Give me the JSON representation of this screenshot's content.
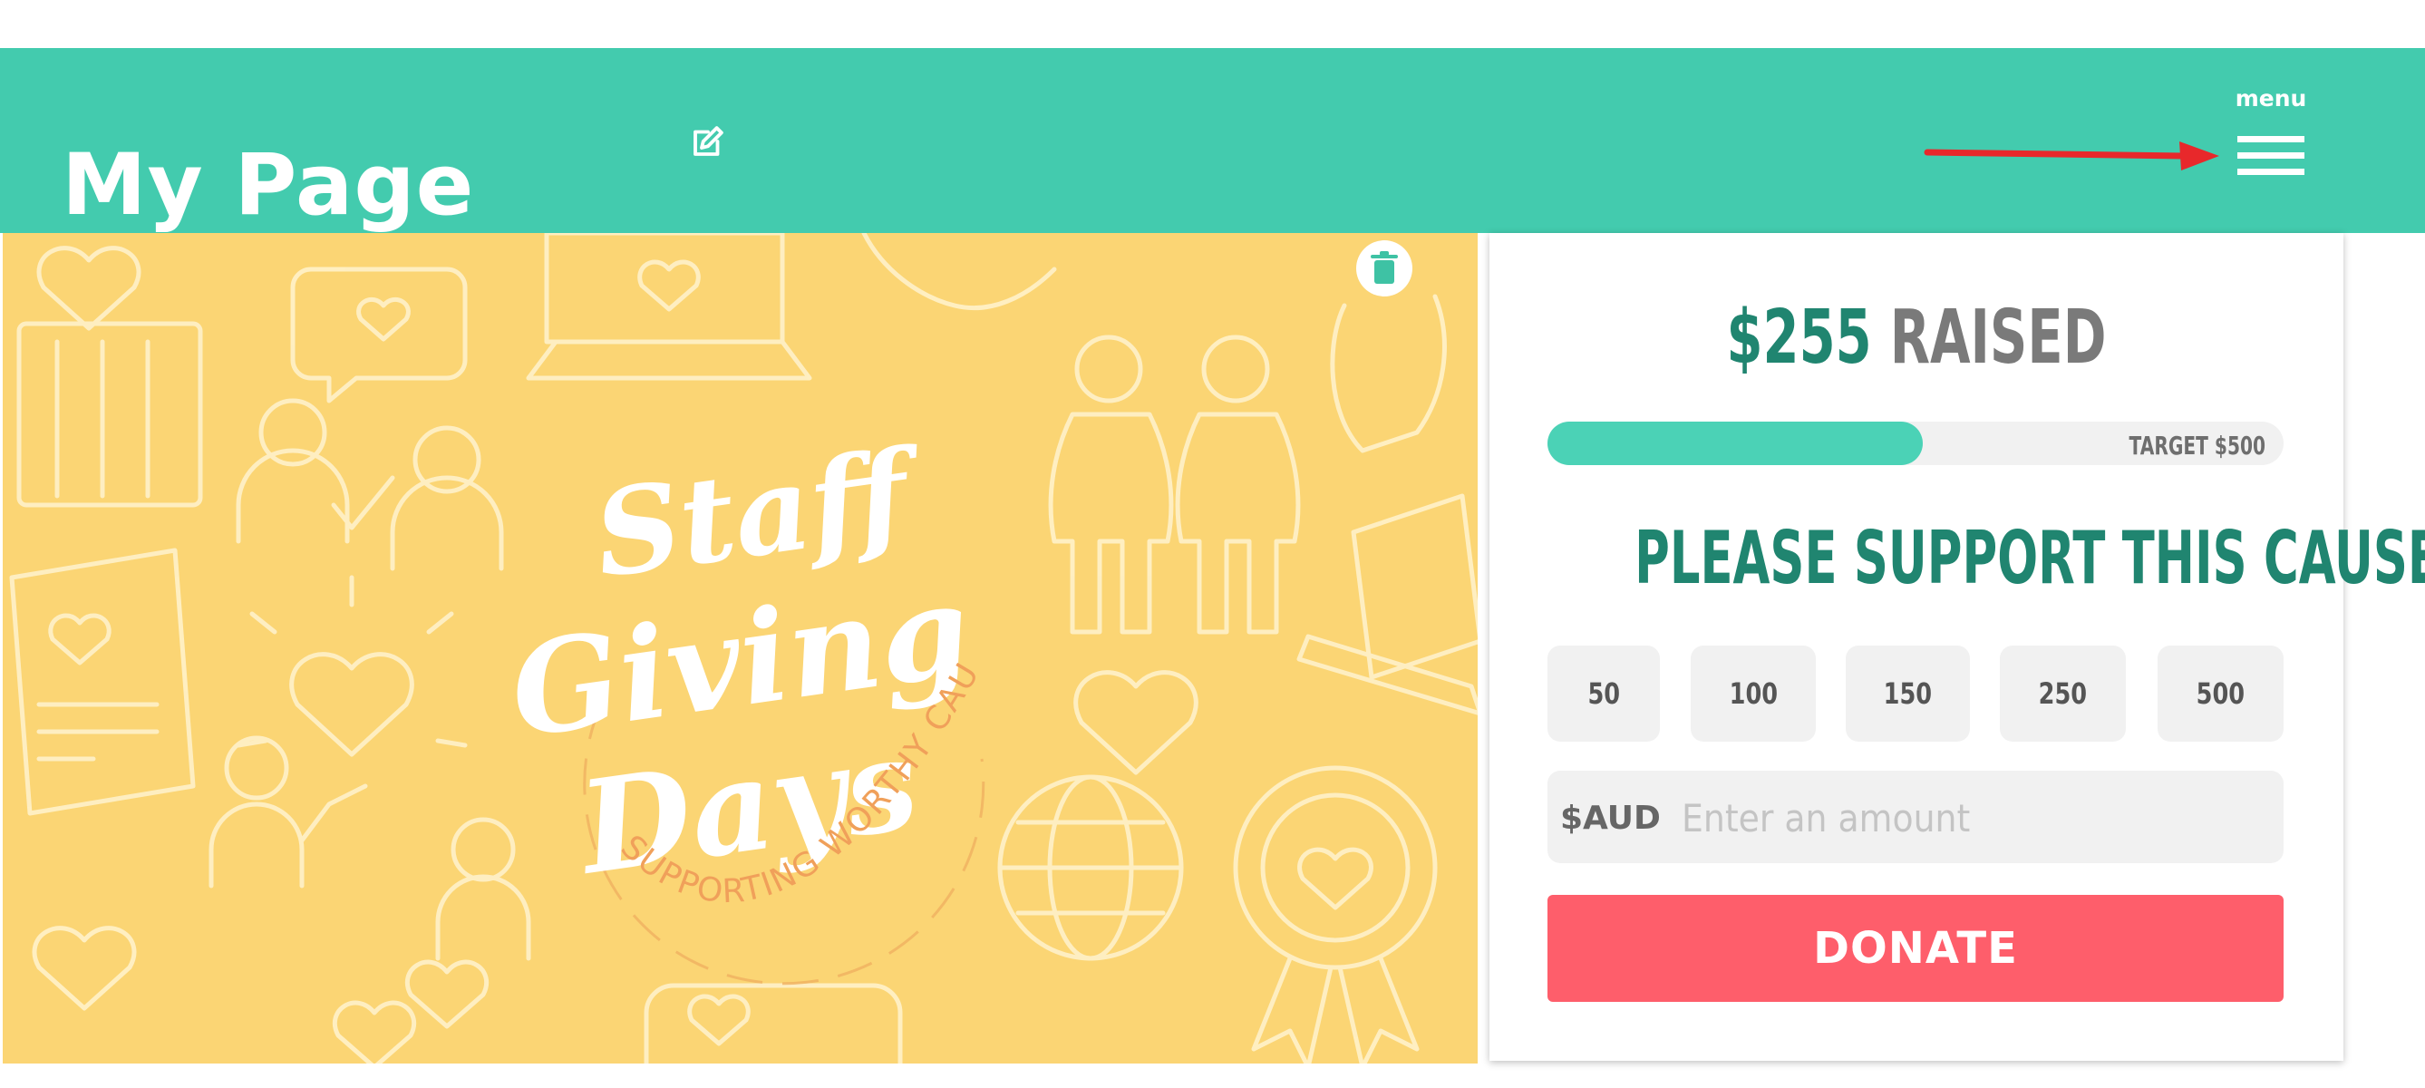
{
  "header": {
    "title": "My Page",
    "menu_label": "menu",
    "icons": {
      "edit": "edit-icon",
      "menu": "hamburger-menu-icon",
      "arrow": "red-arrow-annotation"
    }
  },
  "banner": {
    "logo_line1": "Staff",
    "logo_line2": "Giving",
    "logo_line3": "Days",
    "logo_arc_text": "SUPPORTING WORTHY CAUSES",
    "delete_icon": "trash-icon"
  },
  "donation": {
    "raised_amount": "$255",
    "raised_label": "RAISED",
    "progress_fraction": 0.51,
    "target_text": "TARGET $500",
    "heading": "PLEASE SUPPORT THIS CAUSE",
    "amounts": [
      "50",
      "100",
      "150",
      "250",
      "500"
    ],
    "currency": "$AUD",
    "amount_placeholder": "Enter an amount",
    "donate_label": "DONATE"
  },
  "colors": {
    "header_bg": "#43cbae",
    "banner_bg": "#fbd574",
    "accent_green": "#208570",
    "progress_fill": "#4bd2b6",
    "donate_bg": "#fe5e6b",
    "arrow": "#e8282b"
  }
}
